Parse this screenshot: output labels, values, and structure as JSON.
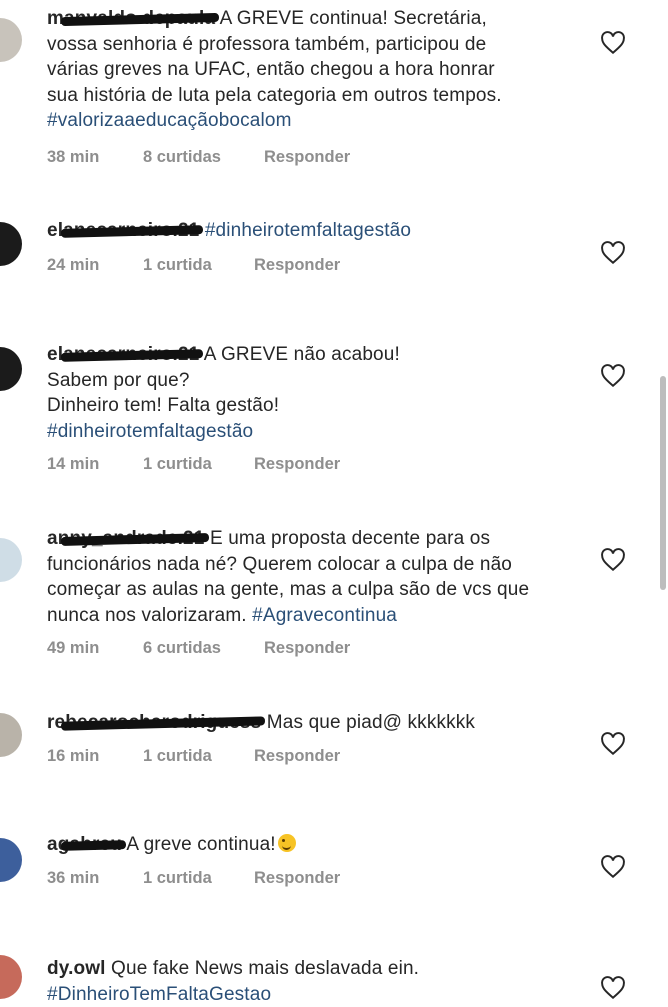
{
  "comments": [
    {
      "username": "manvaldo.depaula",
      "lines": [
        "A GREVE continua! Secretária,",
        "vossa senhoria é professora também, participou de",
        "várias greves na UFAC, então chegou a hora honrar",
        "sua história de luta pela categoria em outros tempos."
      ],
      "hashtag": "#valorizaaeducaçãobocalom",
      "time": "38 min",
      "likes": "8 curtidas",
      "reply": "Responder"
    },
    {
      "username": "elanecarneiro.21",
      "lines": [],
      "hashtag": "#dinheirotemfaltagestão",
      "time": "24 min",
      "likes": "1 curtida",
      "reply": "Responder"
    },
    {
      "username": "elanecarneiro.21",
      "lines": [
        "A GREVE não acabou!",
        "Sabem por que?",
        "Dinheiro tem! Falta gestão!"
      ],
      "hashtag": "#dinheirotemfaltagestão",
      "time": "14 min",
      "likes": "1 curtida",
      "reply": "Responder"
    },
    {
      "username": "anny_andrade.21",
      "lines": [
        "E uma proposta decente para os",
        "funcionários nada né? Querem colocar a culpa de não",
        "começar as aulas na gente, mas a culpa são de vcs que",
        "nunca nos valorizaram."
      ],
      "hashtag": "#Agravecontinua",
      "time": "49 min",
      "likes": "6 curtidas",
      "reply": "Responder"
    },
    {
      "username": "rebecarocharodriguess",
      "lines": [
        "Mas que piad@ kkkkkkk"
      ],
      "hashtag": "",
      "time": "16 min",
      "likes": "1 curtida",
      "reply": "Responder"
    },
    {
      "username": "agabreu",
      "lines": [
        "A greve continua!"
      ],
      "hashtag": "",
      "time": "36 min",
      "likes": "1 curtida",
      "reply": "Responder"
    },
    {
      "username": "dy.owl",
      "lines": [
        "Que fake News mais deslavada ein."
      ],
      "hashtag": "#DinheiroTemFaltaGestao",
      "time": "",
      "likes": "",
      "reply": ""
    }
  ],
  "icons": {
    "like": "heart-outline-icon",
    "emoji": "winking-face-emoji"
  },
  "colors": {
    "hashtag": "#2a4f77",
    "meta": "#8e8e8e",
    "text": "#262626"
  }
}
